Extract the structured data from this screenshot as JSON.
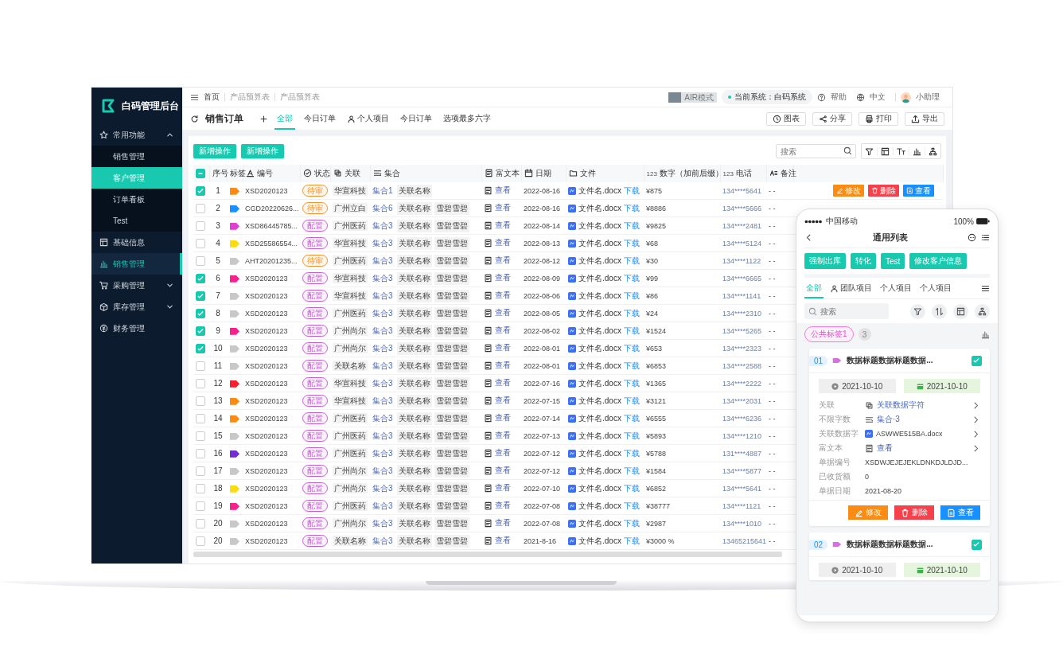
{
  "sidebar": {
    "logo": "白码管理后台",
    "menu": [
      {
        "label": "常用功能",
        "selected": false,
        "expanded": true,
        "children": [
          {
            "label": "销售管理",
            "selected": false
          },
          {
            "label": "客户管理",
            "selected": true
          },
          {
            "label": "订单看板",
            "selected": false
          },
          {
            "label": "Test",
            "selected": false
          }
        ]
      },
      {
        "label": "基础信息",
        "selected": false
      },
      {
        "label": "销售管理",
        "selected": true
      },
      {
        "label": "采购管理",
        "selected": false,
        "expanded": false
      },
      {
        "label": "库存管理",
        "selected": false,
        "expanded": false
      },
      {
        "label": "财务管理",
        "selected": false
      }
    ]
  },
  "topbar": {
    "breadcrumbs": [
      "首页",
      "产品预算表",
      "产品预算表"
    ],
    "air_mode": {
      "label": "AIR模式",
      "on": false
    },
    "system": "当前系统：白码系统",
    "help": "帮助",
    "language": "中文",
    "user": "小助理"
  },
  "page": {
    "title": "销售订单",
    "tabs": [
      {
        "label": "全部",
        "selected": true,
        "kind": "plain"
      },
      {
        "label": "今日订单",
        "selected": false,
        "kind": "plain"
      },
      {
        "label": "个人项目",
        "selected": false,
        "kind": "person"
      },
      {
        "label": "今日订单",
        "selected": false,
        "kind": "plain"
      },
      {
        "label": "选项最多六字",
        "selected": false,
        "kind": "plain"
      }
    ],
    "actions": [
      "图表",
      "分享",
      "打印",
      "导出"
    ]
  },
  "toolbar": {
    "buttons": [
      "新增操作",
      "新增操作"
    ],
    "search": {
      "placeholder": "搜索"
    }
  },
  "table": {
    "indeterminate": true,
    "columns": [
      {
        "label": "序号"
      },
      {
        "label": "标签"
      },
      {
        "label": "编号"
      },
      {
        "label": "状态"
      },
      {
        "label": "关联"
      },
      {
        "label": "集合"
      },
      {
        "label": "富文本"
      },
      {
        "label": "日期"
      },
      {
        "label": "文件"
      },
      {
        "label": "数字（加前后缀）",
        "prefix": "123"
      },
      {
        "label": "电话",
        "prefix": "123"
      },
      {
        "label": "备注"
      }
    ],
    "rows": [
      {
        "checked": true,
        "index": "1",
        "color": "#fa8c16",
        "code": "XSD2020123",
        "status": {
          "text": "待审",
          "kind": "pending"
        },
        "relation": "华宣科技",
        "collection": "集合1",
        "collection_tags": [
          "关联名称"
        ],
        "rich_text": "查看",
        "date": "2022-08-16",
        "file": "文件名.docx",
        "download": "下载",
        "amount": "¥875",
        "phone": "134****5641",
        "note": "- -",
        "actions": [
          {
            "label": "修改",
            "kind": "edit"
          },
          {
            "label": "删除",
            "kind": "delete"
          },
          {
            "label": "查看",
            "kind": "view"
          }
        ]
      },
      {
        "checked": false,
        "index": "2",
        "color": "#1890ff",
        "code": "CGD20220626...",
        "status": {
          "text": "待审",
          "kind": "pending"
        },
        "relation": "广州立白",
        "collection": "集合6",
        "collection_tags": [
          "关联名称",
          "雪碧雪碧"
        ],
        "rich_text": "查看",
        "date": "2022-08-16",
        "file": "文件名.docx",
        "download": "下载",
        "amount": "¥8886",
        "phone": "134****5666",
        "note": "- -"
      },
      {
        "checked": false,
        "index": "3",
        "color": "#e040d0",
        "code": "XSD86445785...",
        "status": {
          "text": "配置",
          "kind": "config"
        },
        "relation": "广州医药",
        "collection": "集合3",
        "collection_tags": [
          "关联名称",
          "雪碧雪碧"
        ],
        "rich_text": "查看",
        "date": "2022-08-14",
        "file": "文件名.docx",
        "download": "下载",
        "amount": "¥9825",
        "phone": "134****2481",
        "note": "- -"
      },
      {
        "checked": false,
        "index": "4",
        "color": "#fadb14",
        "code": "XSD25586554...",
        "status": {
          "text": "配置",
          "kind": "config"
        },
        "relation": "华宣科技",
        "collection": "集合3",
        "collection_tags": [
          "关联名称",
          "雪碧雪碧"
        ],
        "rich_text": "查看",
        "date": "2022-08-13",
        "file": "文件名.docx",
        "download": "下载",
        "amount": "¥68",
        "phone": "134****5124",
        "note": "- -"
      },
      {
        "checked": false,
        "index": "5",
        "color": "#c8c8c8",
        "code": "AHT20201235...",
        "status": {
          "text": "待审",
          "kind": "pending"
        },
        "relation": "广州医药",
        "collection": "集合3",
        "collection_tags": [
          "关联名称",
          "雪碧雪碧"
        ],
        "rich_text": "查看",
        "date": "2022-08-12",
        "file": "文件名.docx",
        "download": "下载",
        "amount": "¥30",
        "phone": "134****1122",
        "note": "- -"
      },
      {
        "checked": true,
        "index": "6",
        "color": "#f5228e",
        "code": "XSD2020123",
        "status": {
          "text": "配置",
          "kind": "config"
        },
        "relation": "华宣科技",
        "collection": "集合3",
        "collection_tags": [
          "关联名称",
          "雪碧雪碧"
        ],
        "rich_text": "查看",
        "date": "2022-08-09",
        "file": "文件名.docx",
        "download": "下载",
        "amount": "¥99",
        "phone": "134****6665",
        "note": "- -"
      },
      {
        "checked": true,
        "index": "7",
        "color": "#c8c8c8",
        "code": "XSD2020123",
        "status": {
          "text": "配置",
          "kind": "config"
        },
        "relation": "华宣科技",
        "collection": "集合3",
        "collection_tags": [
          "关联名称",
          "雪碧雪碧"
        ],
        "rich_text": "查看",
        "date": "2022-08-06",
        "file": "文件名.docx",
        "download": "下载",
        "amount": "¥86",
        "phone": "134****1141",
        "note": "- -"
      },
      {
        "checked": true,
        "index": "8",
        "color": "#c8c8c8",
        "code": "XSD2020123",
        "status": {
          "text": "配置",
          "kind": "config"
        },
        "relation": "广州医药",
        "collection": "集合3",
        "collection_tags": [
          "关联名称",
          "雪碧雪碧"
        ],
        "rich_text": "查看",
        "date": "2022-08-05",
        "file": "文件名.docx",
        "download": "下载",
        "amount": "¥24",
        "phone": "134****2310",
        "note": "- -"
      },
      {
        "checked": true,
        "index": "9",
        "color": "#f5228e",
        "code": "XSD2020123",
        "status": {
          "text": "配置",
          "kind": "config"
        },
        "relation": "广州尚尔",
        "collection": "集合3",
        "collection_tags": [
          "关联名称",
          "雪碧雪碧"
        ],
        "rich_text": "查看",
        "date": "2022-08-02",
        "file": "文件名.docx",
        "download": "下载",
        "amount": "¥1524",
        "phone": "134****5265",
        "note": "- -"
      },
      {
        "checked": true,
        "index": "10",
        "color": "#c8c8c8",
        "code": "XSD2020123",
        "status": {
          "text": "配置",
          "kind": "config"
        },
        "relation": "广州尚尔",
        "collection": "集合3",
        "collection_tags": [
          "关联名称",
          "雪碧雪碧"
        ],
        "rich_text": "查看",
        "date": "2022-08-01",
        "file": "文件名.docx",
        "download": "下载",
        "amount": "¥653",
        "phone": "134****2323",
        "note": "- -"
      },
      {
        "checked": false,
        "index": "11",
        "color": "#c8c8c8",
        "code": "XSD2020123",
        "status": {
          "text": "配置",
          "kind": "config"
        },
        "relation": "关联名称",
        "collection": "集合3",
        "collection_tags": [
          "关联名称",
          "雪碧雪碧"
        ],
        "rich_text": "查看",
        "date": "2022-08-01",
        "file": "文件名.docx",
        "download": "下载",
        "amount": "¥6853",
        "phone": "134****2588",
        "note": "- -"
      },
      {
        "checked": false,
        "index": "12",
        "color": "#f5222d",
        "code": "XSD2020123",
        "status": {
          "text": "配置",
          "kind": "config"
        },
        "relation": "华宣科技",
        "collection": "集合3",
        "collection_tags": [
          "关联名称",
          "雪碧雪碧"
        ],
        "rich_text": "查看",
        "date": "2022-07-16",
        "file": "文件名.docx",
        "download": "下载",
        "amount": "¥1365",
        "phone": "134****2222",
        "note": "- -"
      },
      {
        "checked": false,
        "index": "13",
        "color": "#fa8c16",
        "code": "XSD2020123",
        "status": {
          "text": "配置",
          "kind": "config"
        },
        "relation": "华宣科技",
        "collection": "集合3",
        "collection_tags": [
          "关联名称",
          "雪碧雪碧"
        ],
        "rich_text": "查看",
        "date": "2022-07-15",
        "file": "文件名.docx",
        "download": "下载",
        "amount": "¥3121",
        "phone": "134****2031",
        "note": "- -"
      },
      {
        "checked": false,
        "index": "14",
        "color": "#fa8c16",
        "code": "XSD2020123",
        "status": {
          "text": "配置",
          "kind": "config"
        },
        "relation": "广州医药",
        "collection": "集合3",
        "collection_tags": [
          "关联名称",
          "雪碧雪碧"
        ],
        "rich_text": "查看",
        "date": "2022-07-14",
        "file": "文件名.docx",
        "download": "下载",
        "amount": "¥6555",
        "phone": "134****6236",
        "note": "- -"
      },
      {
        "checked": false,
        "index": "15",
        "color": "#c8c8c8",
        "code": "XSD2020123",
        "status": {
          "text": "配置",
          "kind": "config"
        },
        "relation": "广州医药",
        "collection": "集合3",
        "collection_tags": [
          "关联名称",
          "雪碧雪碧"
        ],
        "rich_text": "查看",
        "date": "2022-07-13",
        "file": "文件名.docx",
        "download": "下载",
        "amount": "¥5893",
        "phone": "134****1210",
        "note": "- -"
      },
      {
        "checked": false,
        "index": "16",
        "color": "#722ed1",
        "code": "XSD2020123",
        "status": {
          "text": "配置",
          "kind": "config"
        },
        "relation": "广州医药",
        "collection": "集合3",
        "collection_tags": [
          "关联名称",
          "雪碧雪碧"
        ],
        "rich_text": "查看",
        "date": "2022-07-12",
        "file": "文件名.docx",
        "download": "下载",
        "amount": "¥5788",
        "phone": "131****4887",
        "note": "- -"
      },
      {
        "checked": false,
        "index": "17",
        "color": "#c8c8c8",
        "code": "XSD2020123",
        "status": {
          "text": "配置",
          "kind": "config"
        },
        "relation": "广州尚尔",
        "collection": "集合3",
        "collection_tags": [
          "关联名称",
          "雪碧雪碧"
        ],
        "rich_text": "查看",
        "date": "2022-07-12",
        "file": "文件名.docx",
        "download": "下载",
        "amount": "¥1584",
        "phone": "134****5877",
        "note": "- -"
      },
      {
        "checked": false,
        "index": "18",
        "color": "#fadb14",
        "code": "XSD2020123",
        "status": {
          "text": "配置",
          "kind": "config"
        },
        "relation": "广州尚尔",
        "collection": "集合3",
        "collection_tags": [
          "关联名称",
          "雪碧雪碧"
        ],
        "rich_text": "查看",
        "date": "2022-07-10",
        "file": "文件名.docx",
        "download": "下载",
        "amount": "¥6852",
        "phone": "134****5641",
        "note": "- -"
      },
      {
        "checked": false,
        "index": "19",
        "color": "#f5228e",
        "code": "XSD2020123",
        "status": {
          "text": "配置",
          "kind": "config"
        },
        "relation": "广州医药",
        "collection": "集合3",
        "collection_tags": [
          "关联名称",
          "雪碧雪碧"
        ],
        "rich_text": "查看",
        "date": "2022-07-08",
        "file": "文件名.docx",
        "download": "下载",
        "amount": "¥38777",
        "phone": "134****1121",
        "note": "- -"
      },
      {
        "checked": false,
        "index": "20",
        "color": "#c8c8c8",
        "code": "XSD2020123",
        "status": {
          "text": "配置",
          "kind": "config"
        },
        "relation": "广州尚尔",
        "collection": "集合3",
        "collection_tags": [
          "关联名称",
          "雪碧雪碧"
        ],
        "rich_text": "查看",
        "date": "2022-07-08",
        "file": "文件名.docx",
        "download": "下载",
        "amount": "¥2987",
        "phone": "134****1010",
        "note": "- -"
      },
      {
        "checked": false,
        "index": "20",
        "color": "#c8c8c8",
        "code": "XSD2020123",
        "status": {
          "text": "配置",
          "kind": "config"
        },
        "relation": "关联名称",
        "collection": "集合3",
        "collection_tags": [
          "关联名称",
          "雪碧雪碧"
        ],
        "rich_text": "查看",
        "date": "2021-8-16",
        "file": "文件名.docx",
        "download": "下载",
        "amount": "¥3000 %",
        "phone": "13465215641",
        "note": "- -"
      }
    ]
  },
  "phone": {
    "carrier": "中国移动",
    "battery": "100%",
    "title": "通用列表",
    "buttons": [
      "强制出库",
      "转化",
      "Test",
      "修改客户信息"
    ],
    "tabs": [
      {
        "label": "全部",
        "selected": true,
        "kind": "plain"
      },
      {
        "label": "团队项目",
        "selected": false,
        "kind": "person"
      },
      {
        "label": "个人项目",
        "selected": false,
        "kind": "plain"
      },
      {
        "label": "个人项目",
        "selected": false,
        "kind": "plain"
      }
    ],
    "search": {
      "placeholder": "搜索"
    },
    "group": {
      "label": "公共标签1",
      "count": "3"
    },
    "cards": [
      {
        "number": "01",
        "title": "数据标题数据标题数据...",
        "checked": true,
        "dates": [
          {
            "text": "2021-10-10",
            "kind": "start"
          },
          {
            "text": "2021-10-10",
            "kind": "end"
          }
        ],
        "fields": [
          {
            "label": "关联",
            "value": "关联数据字符",
            "kind": "relation"
          },
          {
            "label": "不限字数",
            "value": "集合·3",
            "kind": "collection"
          },
          {
            "label": "关联数据字",
            "value": "ASWWE515BA.docx",
            "kind": "file"
          },
          {
            "label": "富文本",
            "value": "查看",
            "kind": "rich"
          },
          {
            "label": "单据编号",
            "value": "XSDWJEJEJEKLDNKDJLDJD...",
            "kind": "text"
          },
          {
            "label": "已收货额",
            "value": "0",
            "kind": "text"
          },
          {
            "label": "单据日期",
            "value": "2021-08-20",
            "kind": "text"
          }
        ],
        "actions": [
          {
            "label": "修改",
            "kind": "edit"
          },
          {
            "label": "删除",
            "kind": "delete"
          },
          {
            "label": "查看",
            "kind": "view"
          }
        ]
      },
      {
        "number": "02",
        "title": "数据标题数据标题数据...",
        "checked": true,
        "dates": [
          {
            "text": "2021-10-10",
            "kind": "start"
          },
          {
            "text": "2021-10-10",
            "kind": "end"
          }
        ]
      }
    ]
  }
}
